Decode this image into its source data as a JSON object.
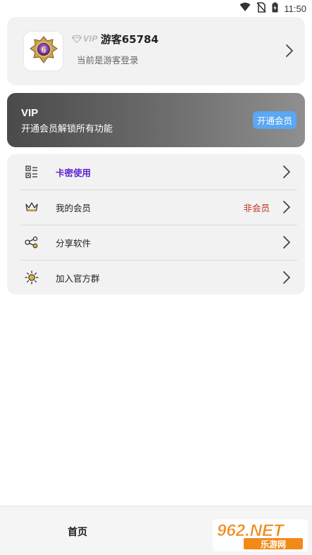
{
  "status_bar": {
    "time": "11:50",
    "icons": [
      "wifi-icon",
      "no-sim-icon",
      "battery-charging-icon"
    ]
  },
  "profile": {
    "vip_badge": "VIP",
    "username": "游客65784",
    "subtitle": "当前是游客登录",
    "avatar_icon": "game-emblem-icon"
  },
  "vip_banner": {
    "title": "VIP",
    "description": "开通会员解锁所有功能",
    "button": "开通会员",
    "button_color": "#5aa7f2"
  },
  "menu": {
    "items": [
      {
        "icon": "card-key-icon",
        "label": "卡密使用",
        "value": ""
      },
      {
        "icon": "crown-icon",
        "label": "我的会员",
        "value": "非会员"
      },
      {
        "icon": "share-icon",
        "label": "分享软件",
        "value": ""
      },
      {
        "icon": "sun-group-icon",
        "label": "加入官方群",
        "value": ""
      }
    ]
  },
  "bottom_nav": {
    "home_label": "首页"
  },
  "watermark": {
    "top": "962.NET",
    "bottom": "乐游网"
  }
}
